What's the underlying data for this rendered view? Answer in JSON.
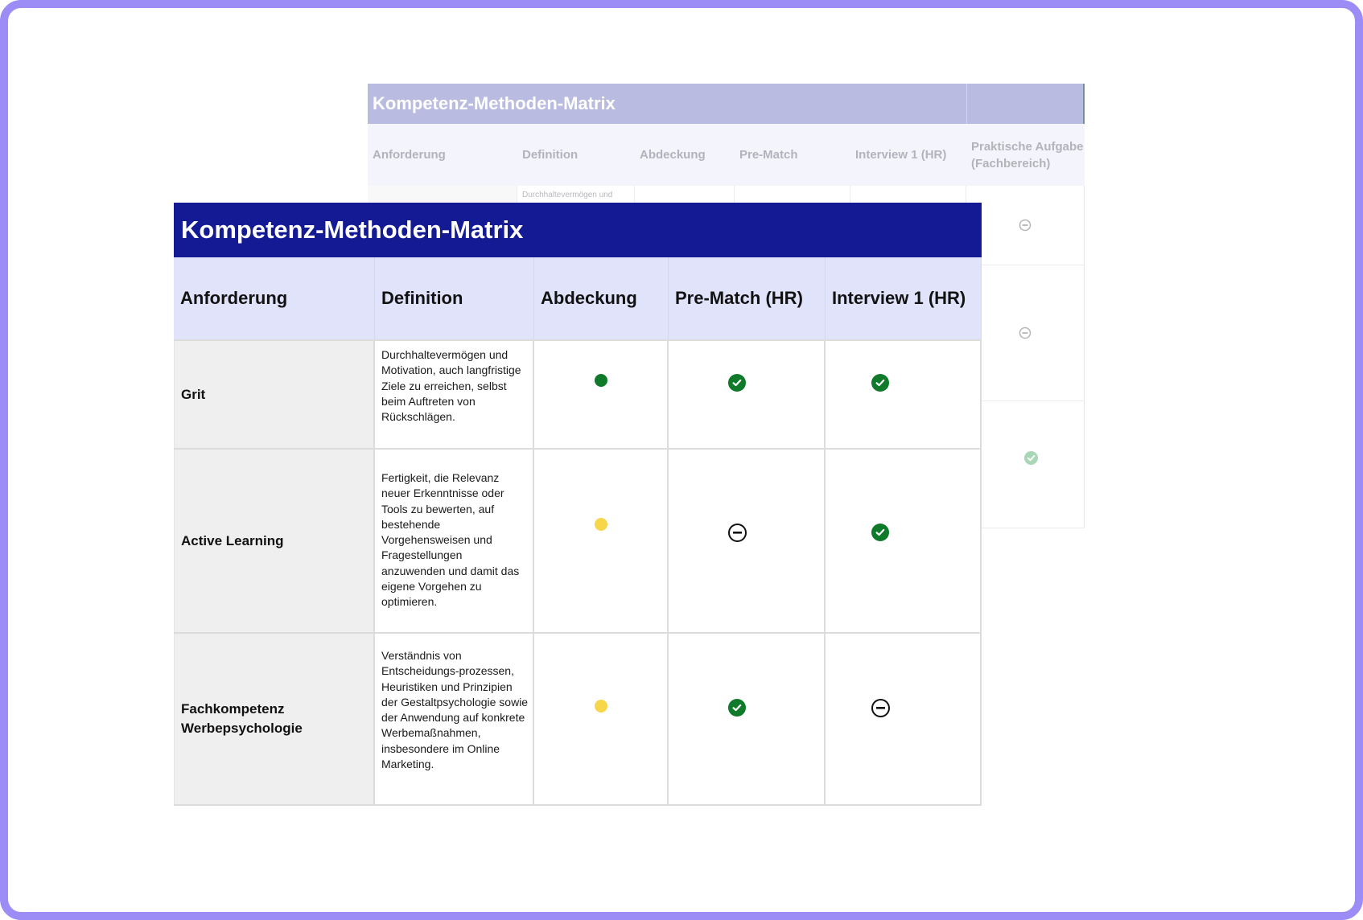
{
  "back_table": {
    "title": "Kompetenz-Methoden-Matrix",
    "headers": [
      "Anforderung",
      "Definition",
      "Abdeckung",
      "Pre-Match",
      "Interview 1 (HR)",
      "Praktische Aufgabe (Fachbereich)"
    ],
    "first_definition_snippet": "Durchhaltevermögen und",
    "last_column_marks": [
      "neutral",
      "neutral",
      "check"
    ]
  },
  "front_table": {
    "title": "Kompetenz-Methoden-Matrix",
    "headers": [
      "Anforderung",
      "Definition",
      "Abdeckung",
      "Pre-Match (HR)",
      "Interview 1 (HR)"
    ],
    "rows": [
      {
        "requirement": "Grit",
        "definition": "Durchhaltevermögen und Motivation, auch langfristige Ziele zu erreichen, selbst beim Auftreten von Rückschlägen.",
        "coverage": "full",
        "prematch": "check",
        "interview": "check"
      },
      {
        "requirement": "Active Learning",
        "definition": "Fertigkeit, die Relevanz neuer Erkenntnisse oder Tools zu bewerten, auf bestehende Vorgehensweisen und Fragestellungen anzuwenden und damit das eigene Vorgehen zu optimieren.",
        "coverage": "partial",
        "prematch": "neutral",
        "interview": "check"
      },
      {
        "requirement": "Fachkompetenz Werbepsychologie",
        "definition": "Verständnis von Entscheidungs-prozessen, Heuristiken und Prinzipien der Gestaltpsychologie sowie der Anwendung auf konkrete Werbemaßnahmen, insbesondere im Online Marketing.",
        "coverage": "partial",
        "prematch": "check",
        "interview": "neutral"
      }
    ]
  },
  "colors": {
    "frame": "#9b8cf6",
    "front_title_bg": "#141a94",
    "front_header_bg": "#e1e3fb",
    "back_title_bg": "#babbe0",
    "coverage_full": "#0f7a2a",
    "coverage_partial": "#f7d64a",
    "check": "#0f7a2a"
  }
}
